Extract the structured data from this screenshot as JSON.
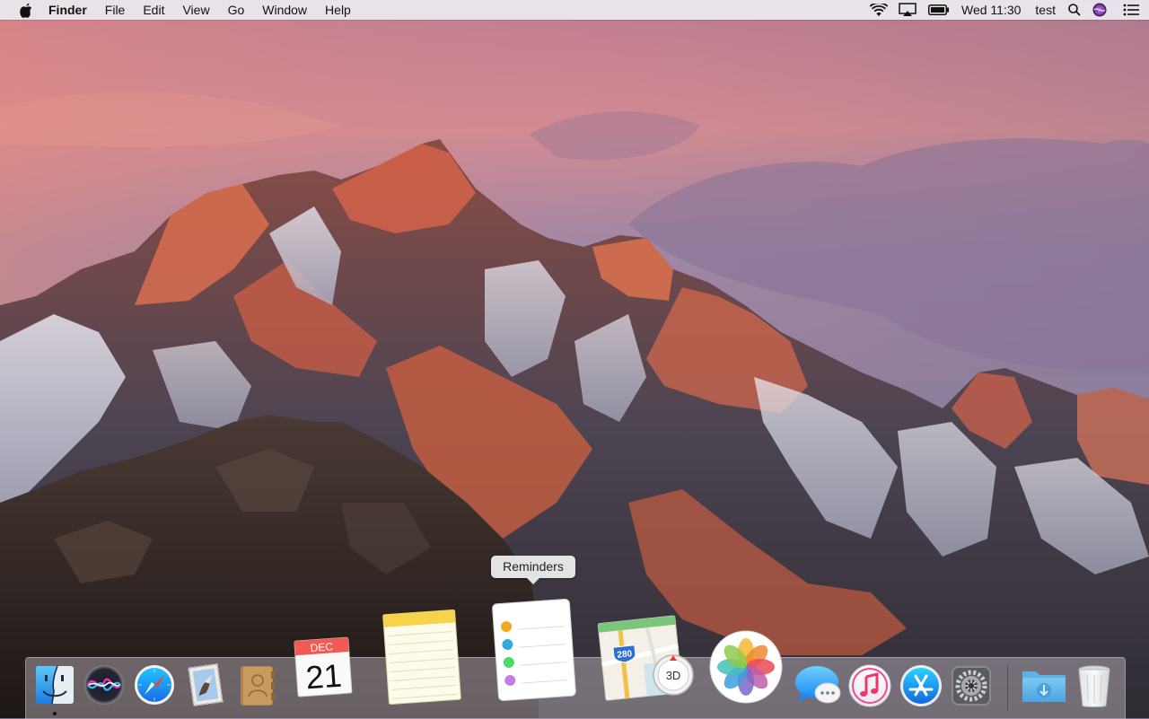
{
  "menubar": {
    "app_name": "Finder",
    "menus": [
      "File",
      "Edit",
      "View",
      "Go",
      "Window",
      "Help"
    ],
    "clock": "Wed 11:30",
    "user": "test",
    "status_icons": [
      "wifi-icon",
      "airplay-icon",
      "battery-icon",
      "spotlight-icon",
      "siri-icon",
      "notification-center-icon"
    ]
  },
  "tooltip": {
    "text": "Reminders"
  },
  "dock": {
    "apps": [
      {
        "name": "Finder",
        "running": true
      },
      {
        "name": "Siri",
        "running": false
      },
      {
        "name": "Safari",
        "running": false
      },
      {
        "name": "Mail",
        "running": false
      },
      {
        "name": "Contacts",
        "running": false
      },
      {
        "name": "Calendar",
        "running": false,
        "month": "DEC",
        "day": "21"
      },
      {
        "name": "Notes",
        "running": false
      },
      {
        "name": "Reminders",
        "running": false,
        "hovered": true
      },
      {
        "name": "Maps",
        "running": false,
        "badge_label": "280",
        "compass_label": "3D"
      },
      {
        "name": "Photos",
        "running": false
      },
      {
        "name": "Messages",
        "running": false
      },
      {
        "name": "iTunes",
        "running": false
      },
      {
        "name": "App Store",
        "running": false
      },
      {
        "name": "System Preferences",
        "running": false
      }
    ],
    "others": [
      {
        "name": "Downloads"
      },
      {
        "name": "Trash"
      }
    ]
  },
  "colors": {
    "menubar_bg": "#ECEAF0",
    "dock_bg": "#D2C8D2",
    "reminders_dots": [
      "#F5A623",
      "#34AADC",
      "#4CD964",
      "#C57BE3"
    ]
  }
}
